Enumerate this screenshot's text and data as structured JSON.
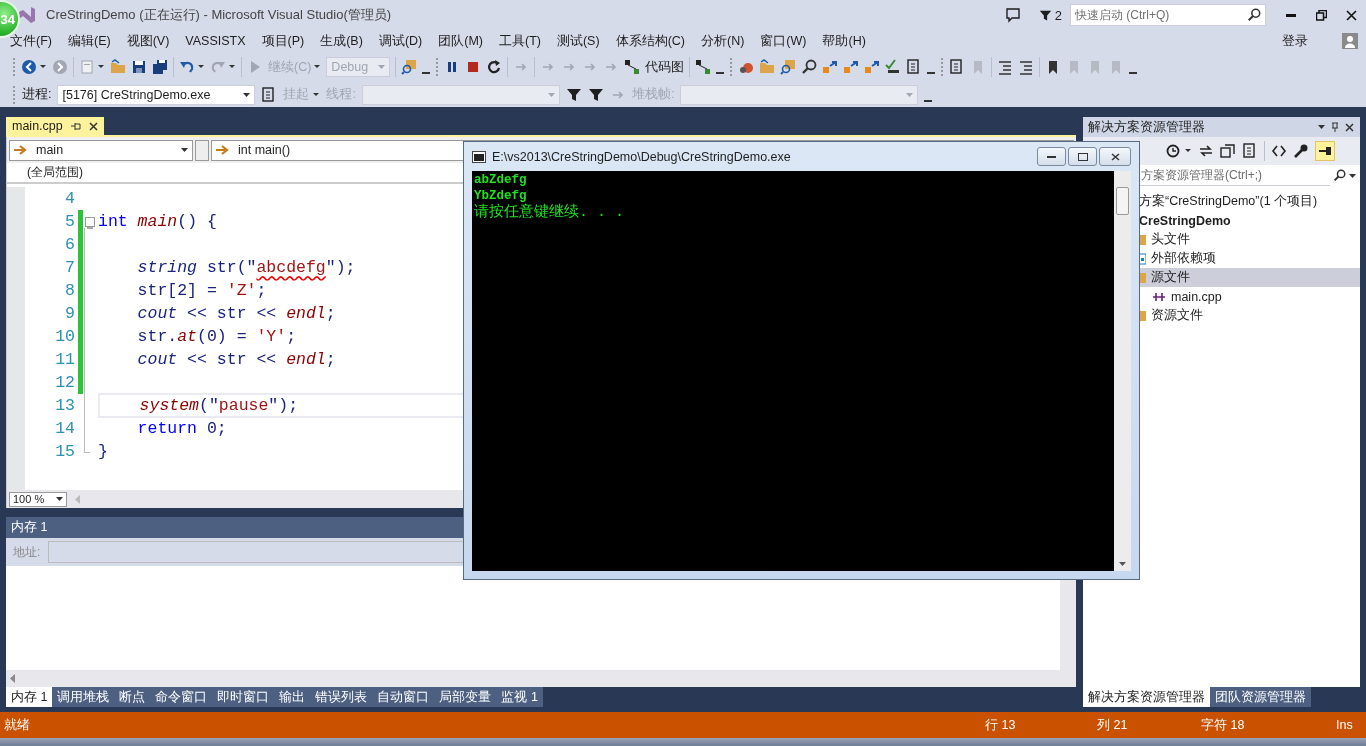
{
  "window": {
    "title": "CreStringDemo (正在运行) - Microsoft Visual Studio(管理员)",
    "notification_count": "2",
    "quick_launch": {
      "placeholder": "快速启动 (Ctrl+Q)"
    },
    "sign_in": "登录"
  },
  "badge": "34",
  "menu": [
    "文件(F)",
    "编辑(E)",
    "视图(V)",
    "VASSISTX",
    "项目(P)",
    "生成(B)",
    "调试(D)",
    "团队(M)",
    "工具(T)",
    "测试(S)",
    "体系结构(C)",
    "分析(N)",
    "窗口(W)",
    "帮助(H)"
  ],
  "debug_toolbar": {
    "continue": "继续(C)",
    "configuration": "Debug",
    "code_map": "代码图"
  },
  "process_bar": {
    "process_label": "进程:",
    "process": "[5176] CreStringDemo.exe",
    "suspend": "挂起",
    "thread_label": "线程:",
    "stack_frame_label": "堆栈帧:"
  },
  "editor": {
    "tab": {
      "label": "main.cpp",
      "selected": true
    },
    "scope": "main",
    "member": "int main()",
    "context": "(全局范围)",
    "zoom": "100 %",
    "lines": [
      {
        "number": "4",
        "changed": false,
        "current": false,
        "fold": false
      },
      {
        "number": "5",
        "changed": true,
        "current": false,
        "fold": true,
        "tokens": [
          {
            "text": "int",
            "kind": "keyword"
          },
          {
            "text": " main",
            "kind": "function"
          },
          {
            "text": "() {",
            "kind": "plain"
          }
        ]
      },
      {
        "number": "6",
        "changed": true,
        "current": false,
        "fold": false
      },
      {
        "number": "7",
        "changed": true,
        "current": false,
        "fold": false,
        "tokens": [
          {
            "text": "    string",
            "kind": "type"
          },
          {
            "text": " str(\"",
            "kind": "plain"
          },
          {
            "text": "abcdefg",
            "kind": "error_string"
          },
          {
            "text": "\");",
            "kind": "plain"
          }
        ]
      },
      {
        "number": "8",
        "changed": true,
        "current": false,
        "fold": false,
        "tokens": [
          {
            "text": "    str[2] = ",
            "kind": "plain"
          },
          {
            "text": "'Z'",
            "kind": "string"
          },
          {
            "text": ";",
            "kind": "plain"
          }
        ]
      },
      {
        "number": "9",
        "changed": true,
        "current": false,
        "fold": false,
        "tokens": [
          {
            "text": "    cout",
            "kind": "type"
          },
          {
            "text": " << str << ",
            "kind": "plain"
          },
          {
            "text": "endl",
            "kind": "function"
          },
          {
            "text": ";",
            "kind": "plain"
          }
        ]
      },
      {
        "number": "10",
        "changed": true,
        "current": false,
        "fold": false,
        "tokens": [
          {
            "text": "    str.",
            "kind": "plain"
          },
          {
            "text": "at",
            "kind": "function"
          },
          {
            "text": "(0) = ",
            "kind": "plain"
          },
          {
            "text": "'Y'",
            "kind": "string"
          },
          {
            "text": ";",
            "kind": "plain"
          }
        ]
      },
      {
        "number": "11",
        "changed": true,
        "current": false,
        "fold": false,
        "tokens": [
          {
            "text": "    cout",
            "kind": "type"
          },
          {
            "text": " << str << ",
            "kind": "plain"
          },
          {
            "text": "endl",
            "kind": "function"
          },
          {
            "text": ";",
            "kind": "plain"
          }
        ]
      },
      {
        "number": "12",
        "changed": true,
        "current": false,
        "fold": false
      },
      {
        "number": "13",
        "changed": false,
        "current": true,
        "fold": false,
        "tokens": [
          {
            "text": "    system",
            "kind": "function"
          },
          {
            "text": "(\"",
            "kind": "plain"
          },
          {
            "text": "pause",
            "kind": "string"
          },
          {
            "text": "\");",
            "kind": "plain"
          }
        ]
      },
      {
        "number": "14",
        "changed": false,
        "current": false,
        "fold": false,
        "tokens": [
          {
            "text": "    return",
            "kind": "keyword"
          },
          {
            "text": " 0;",
            "kind": "plain"
          }
        ]
      },
      {
        "number": "15",
        "changed": false,
        "current": false,
        "fold": false,
        "tokens": [
          {
            "text": "}",
            "kind": "plain"
          }
        ]
      }
    ]
  },
  "memory_panel": {
    "title": "内存 1",
    "address_label": "地址:"
  },
  "bottom_tabs": [
    {
      "label": "内存 1",
      "selected": true
    },
    {
      "label": "调用堆栈",
      "selected": false
    },
    {
      "label": "断点",
      "selected": false
    },
    {
      "label": "命令窗口",
      "selected": false
    },
    {
      "label": "即时窗口",
      "selected": false
    },
    {
      "label": "输出",
      "selected": false
    },
    {
      "label": "错误列表",
      "selected": false
    },
    {
      "label": "自动窗口",
      "selected": false
    },
    {
      "label": "局部变量",
      "selected": false
    },
    {
      "label": "监视 1",
      "selected": false
    }
  ],
  "console": {
    "title": "E:\\vs2013\\CreStringDemo\\Debug\\CreStringDemo.exe",
    "lines": [
      "abZdefg",
      "YbZdefg",
      "请按任意键继续. . ."
    ]
  },
  "solution_explorer": {
    "title": "解决方案资源管理器",
    "search_placeholder": "方案资源管理器(Ctrl+;)",
    "tree": [
      {
        "label": "方案“CreStringDemo”(1 个项目)",
        "selected": false,
        "children": [
          {
            "label": "CreStringDemo",
            "kind": "project",
            "selected": false,
            "children": [
              {
                "label": "头文件",
                "kind": "folder",
                "selected": false
              },
              {
                "label": "外部依赖项",
                "kind": "external",
                "selected": false
              },
              {
                "label": "源文件",
                "kind": "folder",
                "selected": true,
                "children": [
                  {
                    "label": "main.cpp",
                    "kind": "cpp",
                    "selected": false
                  }
                ]
              },
              {
                "label": "资源文件",
                "kind": "folder",
                "selected": false
              }
            ]
          }
        ]
      }
    ]
  },
  "side_tabs": [
    {
      "label": "解决方案资源管理器",
      "selected": true
    },
    {
      "label": "团队资源管理器",
      "selected": false
    }
  ],
  "status_bar": {
    "message": "就绪",
    "line": "行 13",
    "column": "列 21",
    "char": "字符 18",
    "mode": "Ins"
  }
}
